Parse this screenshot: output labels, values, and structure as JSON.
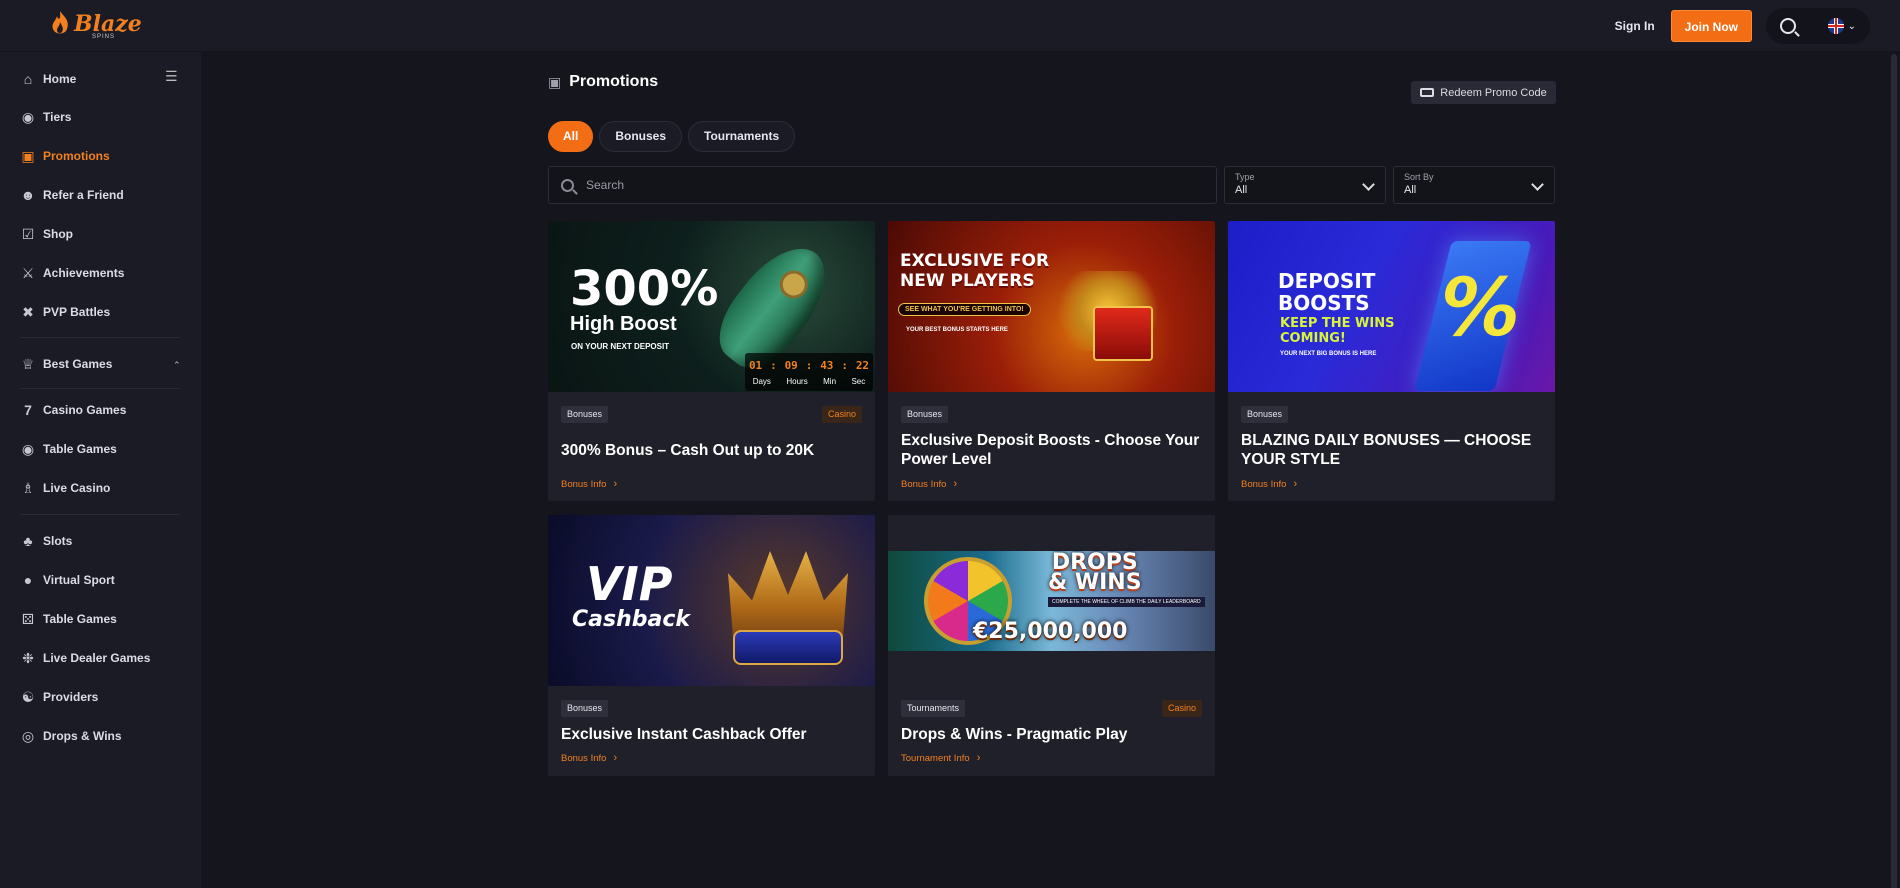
{
  "header": {
    "logo_text": "Blaze",
    "logo_sub": "SPINS",
    "signin_label": "Sign In",
    "join_label": "Join Now"
  },
  "sidebar": {
    "items": [
      {
        "label": "Home",
        "icon": "home-icon"
      },
      {
        "label": "Tiers",
        "icon": "medal-icon"
      },
      {
        "label": "Promotions",
        "icon": "gift-icon"
      },
      {
        "label": "Refer a Friend",
        "icon": "users-icon"
      },
      {
        "label": "Shop",
        "icon": "cart-icon"
      },
      {
        "label": "Achievements",
        "icon": "trophy-icon"
      },
      {
        "label": "PVP Battles",
        "icon": "swords-icon"
      },
      {
        "label": "Best Games",
        "icon": "crown-icon"
      },
      {
        "label": "Casino Games",
        "icon": "seven-icon"
      },
      {
        "label": "Table Games",
        "icon": "chip-icon"
      },
      {
        "label": "Live Casino",
        "icon": "dealer-icon"
      },
      {
        "label": "Slots",
        "icon": "cherry-icon"
      },
      {
        "label": "Virtual Sport",
        "icon": "gamepad-icon"
      },
      {
        "label": "Table Games",
        "icon": "dice-icon"
      },
      {
        "label": "Live Dealer Games",
        "icon": "roulette-icon"
      },
      {
        "label": "Providers",
        "icon": "providers-icon"
      },
      {
        "label": "Drops & Wins",
        "icon": "coins-icon"
      }
    ]
  },
  "main": {
    "title": "Promotions",
    "redeem_label": "Redeem Promo Code",
    "tabs": [
      {
        "label": "All"
      },
      {
        "label": "Bonuses"
      },
      {
        "label": "Tournaments"
      }
    ],
    "search_placeholder": "Search",
    "type_filter": {
      "label": "Type",
      "value": "All"
    },
    "sort_filter": {
      "label": "Sort By",
      "value": "All"
    }
  },
  "cards": [
    {
      "badge": "Bonuses",
      "tag": "Casino",
      "title": "300% Bonus – Cash Out up to 20K",
      "link": "Bonus Info",
      "banner": {
        "headline": "300%",
        "sub": "High Boost",
        "small": "ON YOUR NEXT DEPOSIT",
        "timer": {
          "days": "01",
          "hours": "09",
          "min": "43",
          "sec": "22",
          "l_days": "Days",
          "l_hours": "Hours",
          "l_min": "Min",
          "l_sec": "Sec"
        }
      }
    },
    {
      "badge": "Bonuses",
      "title": "Exclusive Deposit Boosts - Choose Your Power Level",
      "link": "Bonus Info",
      "banner": {
        "line1": "EXCLUSIVE FOR",
        "line2": "NEW PLAYERS",
        "pill": "SEE WHAT YOU'RE GETTING INTO!",
        "small": "YOUR BEST BONUS STARTS HERE"
      }
    },
    {
      "badge": "Bonuses",
      "title": "BLAZING DAILY BONUSES — CHOOSE YOUR STYLE",
      "link": "Bonus Info",
      "banner": {
        "line1": "DEPOSIT",
        "line2": "BOOSTS",
        "line3": "KEEP THE WINS",
        "line4": "COMING!",
        "small": "YOUR NEXT BIG BONUS IS HERE",
        "symbol": "%"
      }
    },
    {
      "badge": "Bonuses",
      "title": "Exclusive Instant Cashback Offer",
      "link": "Bonus Info",
      "banner": {
        "line1": "VIP",
        "line2": "Cashback"
      }
    },
    {
      "badge": "Tournaments",
      "tag": "Casino",
      "title": "Drops & Wins - Pragmatic Play",
      "link": "Tournament Info",
      "banner": {
        "line1": "DROPS",
        "line2": "& WINS",
        "amount": "€25,000,000",
        "sub": "COMPLETE THE WHEEL OF CLIMB THE DAILY LEADERBOARD"
      }
    }
  ]
}
